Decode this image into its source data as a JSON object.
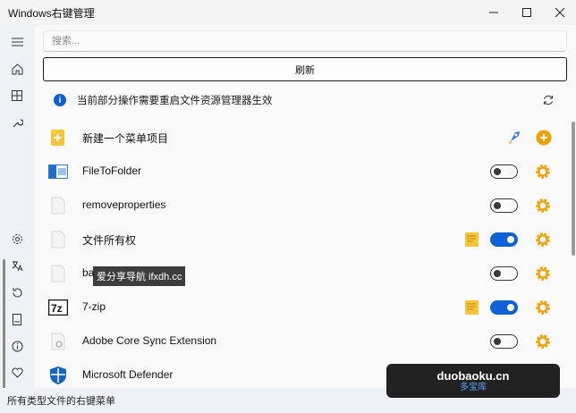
{
  "window": {
    "title": "Windows右键管理"
  },
  "search": {
    "placeholder": "搜索..."
  },
  "toolbar": {
    "refresh_label": "刷新"
  },
  "info": {
    "text": "当前部分操作需要重启文件资源管理器生效"
  },
  "items": [
    {
      "label": "新建一个菜单项目",
      "icon": "new-item-icon",
      "enabled": null
    },
    {
      "label": "FileToFolder",
      "icon": "window-icon",
      "enabled": false
    },
    {
      "label": "removeproperties",
      "icon": "file-icon",
      "enabled": false
    },
    {
      "label": "文件所有权",
      "icon": "file-icon",
      "enabled": true
    },
    {
      "label": "ba",
      "icon": "file-icon",
      "enabled": false
    },
    {
      "label": "7-zip",
      "icon": "7zip-icon",
      "enabled": true
    },
    {
      "label": "Adobe Core Sync Extension",
      "icon": "file-icon",
      "enabled": false
    },
    {
      "label": "Microsoft Defender",
      "icon": "defender-icon",
      "enabled": false
    }
  ],
  "status": {
    "text": "所有类型文件的右键菜单"
  },
  "watermarks": {
    "overlay_text": "爱分享导航 ifxdh.cc",
    "site_main": "duobaoku.cn",
    "site_sub": "多宝库"
  },
  "colors": {
    "accent": "#0f62d6",
    "gear": "#f0a000"
  }
}
